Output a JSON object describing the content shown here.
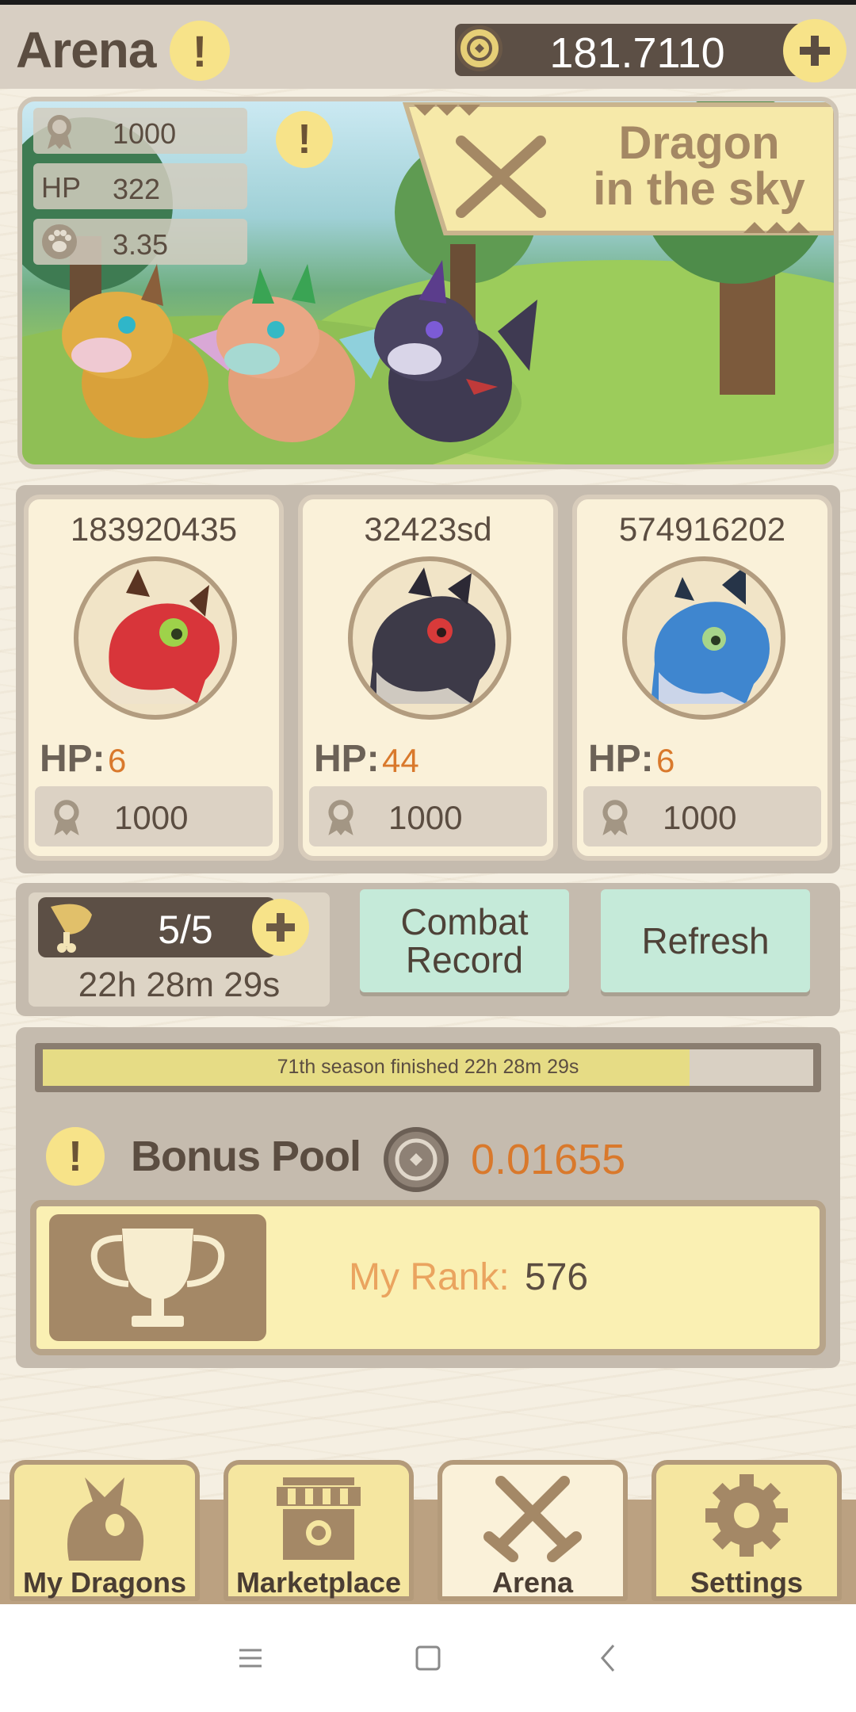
{
  "header": {
    "title": "Arena",
    "info_icon": "exclamation-icon",
    "balance": "181.7110",
    "coin_icon": "coin-icon",
    "add_icon": "plus-icon"
  },
  "banner": {
    "stats": [
      {
        "icon": "rank-badge-icon",
        "label": "",
        "value": "1000"
      },
      {
        "icon": "",
        "label": "HP",
        "value": "322"
      },
      {
        "icon": "paw-icon",
        "label": "",
        "value": "3.35"
      }
    ],
    "info_icon": "exclamation-icon",
    "logo_line1": "Dragon",
    "logo_line2": "in the sky"
  },
  "opponents": [
    {
      "name": "183920435",
      "hp_label": "HP:",
      "hp": "6",
      "score": "1000",
      "dragon_color": "#d8353a"
    },
    {
      "name": "32423sd",
      "hp_label": "HP:",
      "hp": "44",
      "score": "1000",
      "dragon_color": "#3d3a48"
    },
    {
      "name": "574916202",
      "hp_label": "HP:",
      "hp": "6",
      "score": "1000",
      "dragon_color": "#3f86cf"
    }
  ],
  "actions": {
    "stamina": "5/5",
    "stamina_timer": "22h 28m 29s",
    "combat_record_label": "Combat Record",
    "refresh_label": "Refresh"
  },
  "season": {
    "text": "71th season finished 22h 28m 29s",
    "progress": 0.84
  },
  "bonus": {
    "label": "Bonus Pool",
    "value": "0.01655",
    "rank_label": "My Rank:",
    "rank_value": "576"
  },
  "nav": [
    {
      "label": "My Dragons",
      "icon": "dragon-head-icon",
      "active": false
    },
    {
      "label": "Marketplace",
      "icon": "shop-icon",
      "active": false
    },
    {
      "label": "Arena",
      "icon": "crossed-swords-icon",
      "active": true
    },
    {
      "label": "Settings",
      "icon": "gear-icon",
      "active": false
    }
  ],
  "colors": {
    "accent_yellow": "#f7e389",
    "accent_orange": "#d9792c",
    "button_green": "#c5ead9",
    "dark_pill": "#5c4f45"
  }
}
